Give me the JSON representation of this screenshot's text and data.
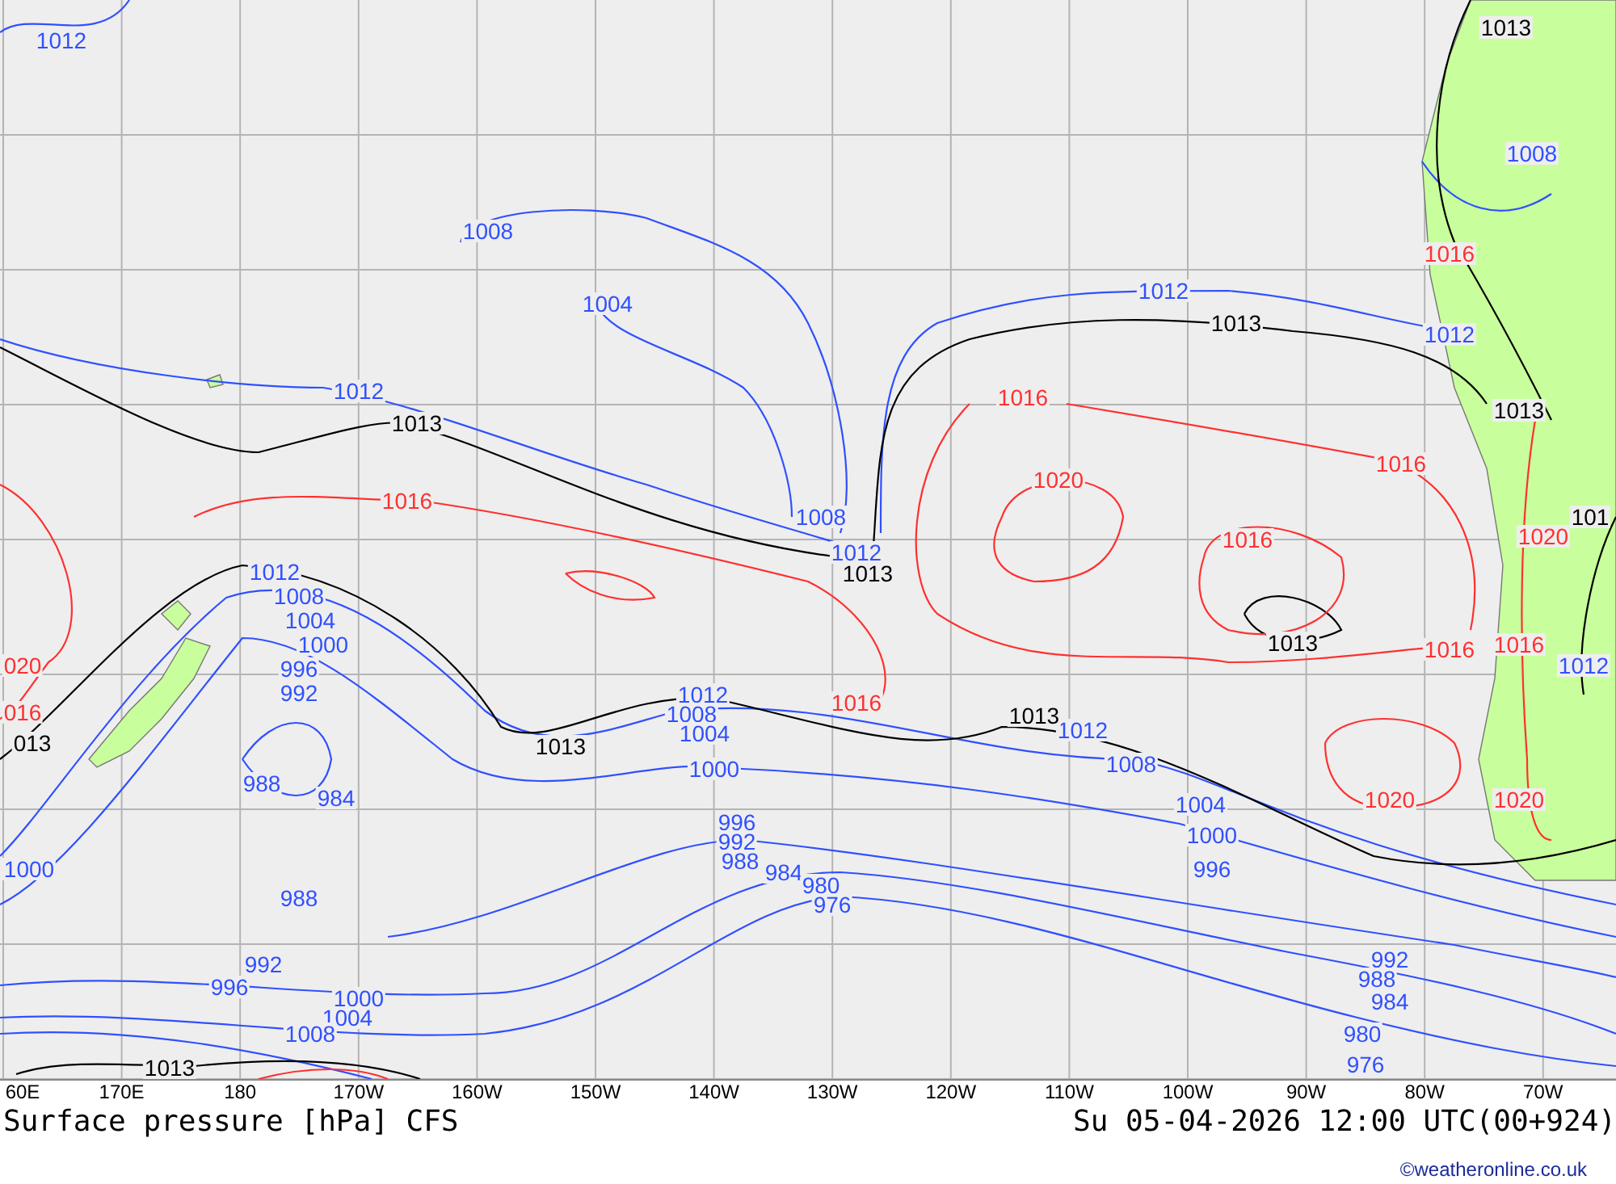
{
  "map": {
    "isobar_labels": [
      {
        "text": "1012",
        "color": "#3050ff"
      },
      {
        "text": "1008",
        "color": "#3050ff"
      },
      {
        "text": "1004",
        "color": "#3050ff"
      },
      {
        "text": "1012",
        "color": "#3050ff"
      },
      {
        "text": "1008",
        "color": "#3050ff"
      },
      {
        "text": "1012",
        "color": "#3050ff"
      },
      {
        "text": "1012",
        "color": "#3050ff"
      },
      {
        "text": "1012",
        "color": "#3050ff"
      },
      {
        "text": "1008",
        "color": "#3050ff"
      },
      {
        "text": "1012",
        "color": "#3050ff"
      },
      {
        "text": "1008",
        "color": "#3050ff"
      },
      {
        "text": "1004",
        "color": "#3050ff"
      },
      {
        "text": "1000",
        "color": "#3050ff"
      },
      {
        "text": "996",
        "color": "#3050ff"
      },
      {
        "text": "992",
        "color": "#3050ff"
      },
      {
        "text": "988",
        "color": "#3050ff"
      },
      {
        "text": "984",
        "color": "#3050ff"
      },
      {
        "text": "988",
        "color": "#3050ff"
      },
      {
        "text": "1000",
        "color": "#3050ff"
      },
      {
        "text": "992",
        "color": "#3050ff"
      },
      {
        "text": "996",
        "color": "#3050ff"
      },
      {
        "text": "1000",
        "color": "#3050ff"
      },
      {
        "text": "1004",
        "color": "#3050ff"
      },
      {
        "text": "1008",
        "color": "#3050ff"
      },
      {
        "text": "1012",
        "color": "#3050ff"
      },
      {
        "text": "1008",
        "color": "#3050ff"
      },
      {
        "text": "1004",
        "color": "#3050ff"
      },
      {
        "text": "1000",
        "color": "#3050ff"
      },
      {
        "text": "996",
        "color": "#3050ff"
      },
      {
        "text": "992",
        "color": "#3050ff"
      },
      {
        "text": "988",
        "color": "#3050ff"
      },
      {
        "text": "984",
        "color": "#3050ff"
      },
      {
        "text": "980",
        "color": "#3050ff"
      },
      {
        "text": "976",
        "color": "#3050ff"
      },
      {
        "text": "1012",
        "color": "#3050ff"
      },
      {
        "text": "1008",
        "color": "#3050ff"
      },
      {
        "text": "1004",
        "color": "#3050ff"
      },
      {
        "text": "1000",
        "color": "#3050ff"
      },
      {
        "text": "996",
        "color": "#3050ff"
      },
      {
        "text": "992",
        "color": "#3050ff"
      },
      {
        "text": "988",
        "color": "#3050ff"
      },
      {
        "text": "984",
        "color": "#3050ff"
      },
      {
        "text": "980",
        "color": "#3050ff"
      },
      {
        "text": "976",
        "color": "#3050ff"
      },
      {
        "text": "1012",
        "color": "#3050ff"
      },
      {
        "text": "1013",
        "color": "#000000"
      },
      {
        "text": "1013",
        "color": "#000000"
      },
      {
        "text": "1013",
        "color": "#000000"
      },
      {
        "text": "1013",
        "color": "#000000"
      },
      {
        "text": "1013",
        "color": "#000000"
      },
      {
        "text": "1013",
        "color": "#000000"
      },
      {
        "text": "1013",
        "color": "#000000"
      },
      {
        "text": "1013",
        "color": "#000000"
      },
      {
        "text": "013",
        "color": "#000000"
      },
      {
        "text": "1013",
        "color": "#000000"
      },
      {
        "text": "101",
        "color": "#000000"
      },
      {
        "text": "1016",
        "color": "#ff3030"
      },
      {
        "text": "1016",
        "color": "#ff3030"
      },
      {
        "text": "1020",
        "color": "#ff3030"
      },
      {
        "text": "1016",
        "color": "#ff3030"
      },
      {
        "text": "1016",
        "color": "#ff3030"
      },
      {
        "text": "1016",
        "color": "#ff3030"
      },
      {
        "text": "1020",
        "color": "#ff3030"
      },
      {
        "text": "1016",
        "color": "#ff3030"
      },
      {
        "text": "1016",
        "color": "#ff3030"
      },
      {
        "text": "1016",
        "color": "#ff3030"
      },
      {
        "text": "1020",
        "color": "#ff3030"
      },
      {
        "text": "1020",
        "color": "#ff3030"
      },
      {
        "text": "020",
        "color": "#ff3030"
      },
      {
        "text": "016",
        "color": "#ff3030"
      }
    ],
    "longitude_labels": [
      "60E",
      "170E",
      "180",
      "170W",
      "160W",
      "150W",
      "140W",
      "130W",
      "120W",
      "110W",
      "100W",
      "90W",
      "80W",
      "70W"
    ]
  },
  "footer": {
    "title": "Surface pressure [hPa] CFS",
    "valid_time": "Su 05-04-2026 12:00 UTC(00+924)",
    "credit": "©weatheronline.co.uk"
  }
}
